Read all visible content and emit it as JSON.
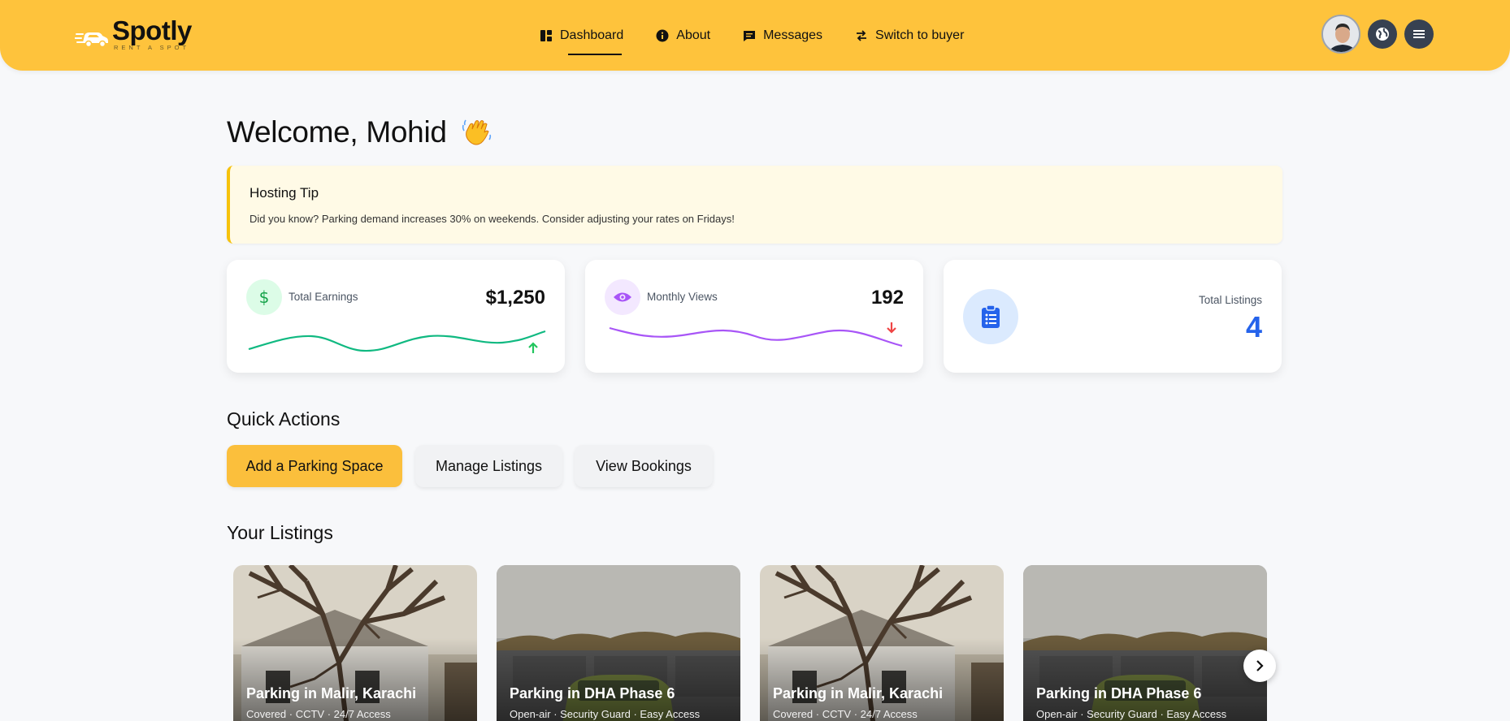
{
  "brand": {
    "name": "Spotly",
    "tagline": "RENT A SPOT"
  },
  "nav": [
    {
      "label": "Dashboard",
      "icon": "dashboard-icon",
      "active": true
    },
    {
      "label": "About",
      "icon": "info-icon",
      "active": false
    },
    {
      "label": "Messages",
      "icon": "message-icon",
      "active": false
    },
    {
      "label": "Switch to buyer",
      "icon": "switch-icon",
      "active": false
    }
  ],
  "header_actions": {
    "avatar": "user-avatar",
    "language": "globe-icon",
    "menu": "hamburger-menu-icon"
  },
  "welcome": {
    "text": "Welcome, Mohid",
    "emoji": "waving-hand"
  },
  "tip": {
    "title": "Hosting Tip",
    "text": "Did you know? Parking demand increases 30% on weekends. Consider adjusting your rates on Fridays!"
  },
  "stats": {
    "earnings": {
      "label": "Total Earnings",
      "value": "$1,250",
      "trend": "up",
      "color": "#22c55e"
    },
    "views": {
      "label": "Monthly Views",
      "value": "192",
      "trend": "down",
      "color": "#a855f7"
    },
    "listings": {
      "label": "Total Listings",
      "value": "4",
      "color": "#2563eb"
    }
  },
  "quick_actions": {
    "title": "Quick Actions",
    "buttons": [
      "Add a Parking Space",
      "Manage Listings",
      "View Bookings"
    ]
  },
  "your_listings": {
    "title": "Your Listings",
    "items": [
      {
        "title": "Parking in Malir, Karachi",
        "features": "Covered · CCTV · 24/7 Access",
        "photo": "tree-house"
      },
      {
        "title": "Parking in DHA Phase 6",
        "features": "Open-air · Security Guard · Easy Access",
        "photo": "car-wall"
      },
      {
        "title": "Parking in Malir, Karachi",
        "features": "Covered · CCTV · 24/7 Access",
        "photo": "tree-house"
      },
      {
        "title": "Parking in DHA Phase 6",
        "features": "Open-air · Security Guard · Easy Access",
        "photo": "car-wall"
      }
    ]
  },
  "colors": {
    "brand_yellow": "#fec33c",
    "accent_blue": "#2563eb"
  }
}
